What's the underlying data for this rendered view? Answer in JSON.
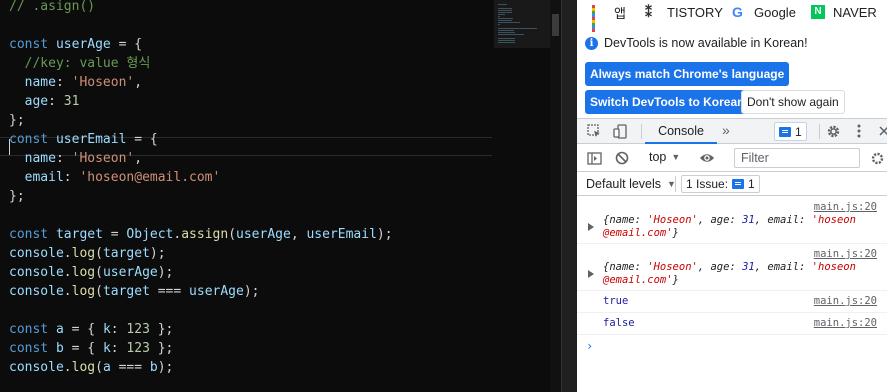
{
  "editor": {
    "lines": [
      [
        [
          "tok-comment",
          "// .asign()"
        ]
      ],
      [],
      [
        [
          "tok-keyword",
          "const"
        ],
        [
          "tok-punct",
          " "
        ],
        [
          "tok-var",
          "userAge"
        ],
        [
          "tok-op",
          " = {"
        ]
      ],
      [
        [
          "tok-punct",
          "  "
        ],
        [
          "tok-comment",
          "//key: value 형식"
        ]
      ],
      [
        [
          "tok-punct",
          "  "
        ],
        [
          "tok-prop",
          "name"
        ],
        [
          "tok-punct",
          ": "
        ],
        [
          "tok-string",
          "'Hoseon'"
        ],
        [
          "tok-punct",
          ","
        ]
      ],
      [
        [
          "tok-punct",
          "  "
        ],
        [
          "tok-prop",
          "age"
        ],
        [
          "tok-punct",
          ": "
        ],
        [
          "tok-number",
          "31"
        ]
      ],
      [
        [
          "tok-punct",
          "};"
        ]
      ],
      [
        [
          "tok-keyword",
          "const"
        ],
        [
          "tok-punct",
          " "
        ],
        [
          "tok-var",
          "userEmail"
        ],
        [
          "tok-op",
          " = {"
        ]
      ],
      [
        [
          "tok-punct",
          "  "
        ],
        [
          "tok-prop",
          "name"
        ],
        [
          "tok-punct",
          ": "
        ],
        [
          "tok-string",
          "'Hoseon'"
        ],
        [
          "tok-punct",
          ","
        ]
      ],
      [
        [
          "tok-punct",
          "  "
        ],
        [
          "tok-prop",
          "email"
        ],
        [
          "tok-punct",
          ": "
        ],
        [
          "tok-string",
          "'hoseon@email.com'"
        ]
      ],
      [
        [
          "tok-punct",
          "};"
        ]
      ],
      [],
      [
        [
          "tok-keyword",
          "const"
        ],
        [
          "tok-punct",
          " "
        ],
        [
          "tok-var",
          "target"
        ],
        [
          "tok-op",
          " = "
        ],
        [
          "tok-var",
          "Object"
        ],
        [
          "tok-punct",
          "."
        ],
        [
          "tok-func",
          "assign"
        ],
        [
          "tok-punct",
          "("
        ],
        [
          "tok-var",
          "userAge"
        ],
        [
          "tok-punct",
          ", "
        ],
        [
          "tok-var",
          "userEmail"
        ],
        [
          "tok-punct",
          ");"
        ]
      ],
      [
        [
          "tok-var",
          "console"
        ],
        [
          "tok-punct",
          "."
        ],
        [
          "tok-func",
          "log"
        ],
        [
          "tok-punct",
          "("
        ],
        [
          "tok-var",
          "target"
        ],
        [
          "tok-punct",
          ");"
        ]
      ],
      [
        [
          "tok-var",
          "console"
        ],
        [
          "tok-punct",
          "."
        ],
        [
          "tok-func",
          "log"
        ],
        [
          "tok-punct",
          "("
        ],
        [
          "tok-var",
          "userAge"
        ],
        [
          "tok-punct",
          ");"
        ]
      ],
      [
        [
          "tok-var",
          "console"
        ],
        [
          "tok-punct",
          "."
        ],
        [
          "tok-func",
          "log"
        ],
        [
          "tok-punct",
          "("
        ],
        [
          "tok-var",
          "target"
        ],
        [
          "tok-op",
          " === "
        ],
        [
          "tok-var",
          "userAge"
        ],
        [
          "tok-punct",
          ");"
        ]
      ],
      [],
      [
        [
          "tok-keyword",
          "const"
        ],
        [
          "tok-punct",
          " "
        ],
        [
          "tok-var",
          "a"
        ],
        [
          "tok-op",
          " = { "
        ],
        [
          "tok-prop",
          "k"
        ],
        [
          "tok-punct",
          ": "
        ],
        [
          "tok-number",
          "123"
        ],
        [
          "tok-punct",
          " };"
        ]
      ],
      [
        [
          "tok-keyword",
          "const"
        ],
        [
          "tok-punct",
          " "
        ],
        [
          "tok-var",
          "b"
        ],
        [
          "tok-op",
          " = { "
        ],
        [
          "tok-prop",
          "k"
        ],
        [
          "tok-punct",
          ": "
        ],
        [
          "tok-number",
          "123"
        ],
        [
          "tok-punct",
          " };"
        ]
      ],
      [
        [
          "tok-var",
          "console"
        ],
        [
          "tok-punct",
          "."
        ],
        [
          "tok-func",
          "log"
        ],
        [
          "tok-punct",
          "("
        ],
        [
          "tok-var",
          "a"
        ],
        [
          "tok-op",
          " === "
        ],
        [
          "tok-var",
          "b"
        ],
        [
          "tok-punct",
          ");"
        ]
      ]
    ]
  },
  "bookmarks": {
    "apps": "앱",
    "tistory": "TISTORY",
    "google": "Google",
    "naver": "NAVER",
    "naver_icon": "N"
  },
  "infobar": {
    "message": "DevTools is now available in Korean!",
    "always_match": "Always match Chrome's language",
    "switch_korean": "Switch DevTools to Korean",
    "dont_show": "Don't show again"
  },
  "devtools": {
    "console_tab": "Console",
    "more_tabs": "»",
    "issues_badge_count": "1",
    "context": "top",
    "filter_placeholder": "Filter",
    "levels": "Default levels",
    "issue_label": "1 Issue:",
    "issue_count": "1"
  },
  "console": {
    "entries": [
      {
        "source": "main.js:20",
        "type": "object",
        "line1": [
          [
            "k",
            "{name: "
          ],
          [
            "s",
            "'Hoseon'"
          ],
          [
            "k",
            ", age: "
          ],
          [
            "n",
            "31"
          ],
          [
            "k",
            ", email: "
          ],
          [
            "s",
            "'hoseon"
          ]
        ],
        "line2": [
          [
            "s",
            "@email.com'"
          ],
          [
            "k",
            "}"
          ]
        ]
      },
      {
        "source": "main.js:20",
        "type": "object",
        "line1": [
          [
            "k",
            "{name: "
          ],
          [
            "s",
            "'Hoseon'"
          ],
          [
            "k",
            ", age: "
          ],
          [
            "n",
            "31"
          ],
          [
            "k",
            ", email: "
          ],
          [
            "s",
            "'hoseon"
          ]
        ],
        "line2": [
          [
            "s",
            "@email.com'"
          ],
          [
            "k",
            "}"
          ]
        ]
      },
      {
        "source": "main.js:20",
        "type": "text",
        "text": "true"
      },
      {
        "source": "main.js:20",
        "type": "text",
        "text": "false"
      }
    ],
    "prompt": "›"
  }
}
